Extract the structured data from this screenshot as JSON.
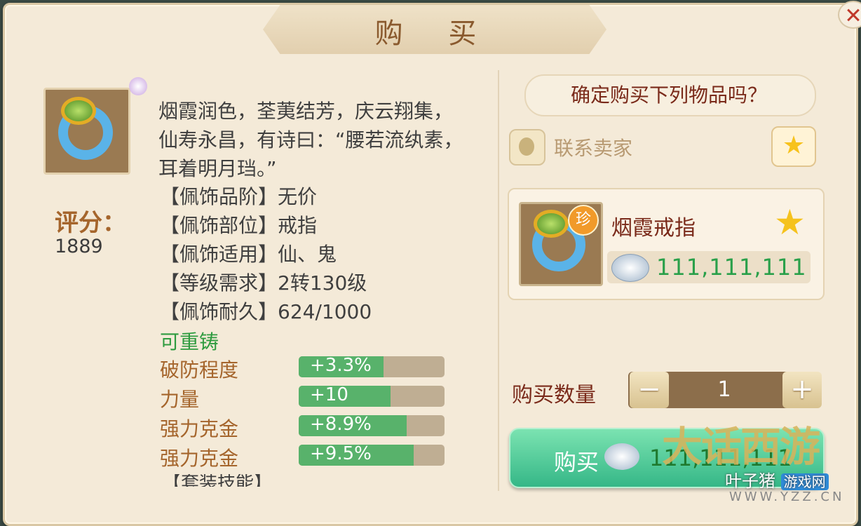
{
  "title": "购 买",
  "left": {
    "score_label": "评分：",
    "score_value": "1889",
    "description": "烟霞润色，荃荑结芳，庆云翔集，仙寿永昌，有诗曰：“腰若流纨素，耳着明月珰。”",
    "properties": [
      {
        "label": "【佩饰品阶】",
        "value": "无价"
      },
      {
        "label": "【佩饰部位】",
        "value": "戒指"
      },
      {
        "label": "【佩饰适用】",
        "value": "仙、鬼"
      },
      {
        "label": "【等级需求】",
        "value": "2转130级"
      },
      {
        "label": "【佩饰耐久】",
        "value": "624/1000"
      }
    ],
    "recast": "可重铸",
    "stats": [
      {
        "label": "破防程度",
        "value": "+3.3%",
        "fill": 0.58
      },
      {
        "label": "力量",
        "value": "+10",
        "fill": 0.63
      },
      {
        "label": "强力克金",
        "value": "+8.9%",
        "fill": 0.74
      },
      {
        "label": "强力克金",
        "value": "+9.5%",
        "fill": 0.79
      }
    ],
    "cut_text": "【套装技能】"
  },
  "right": {
    "confirm": "确定购买下列物品吗？",
    "contact_seller": "联系卖家",
    "item_name": "烟霞戒指",
    "rare_badge": "珍",
    "price": "111,111,111",
    "quantity_label": "购买数量",
    "quantity": "1",
    "minus": "−",
    "plus": "+",
    "buy_label": "购买",
    "buy_price": "111,111,111"
  },
  "watermark": {
    "logo": "大话西游",
    "site": "叶子猪",
    "site_badge": "游戏网",
    "url": "WWW.YZZ.CN"
  },
  "colors": {
    "panel": "#f4ead8",
    "accent_text": "#7a2a1a",
    "green": "#2aa04a",
    "buy_button": "#35b787"
  }
}
